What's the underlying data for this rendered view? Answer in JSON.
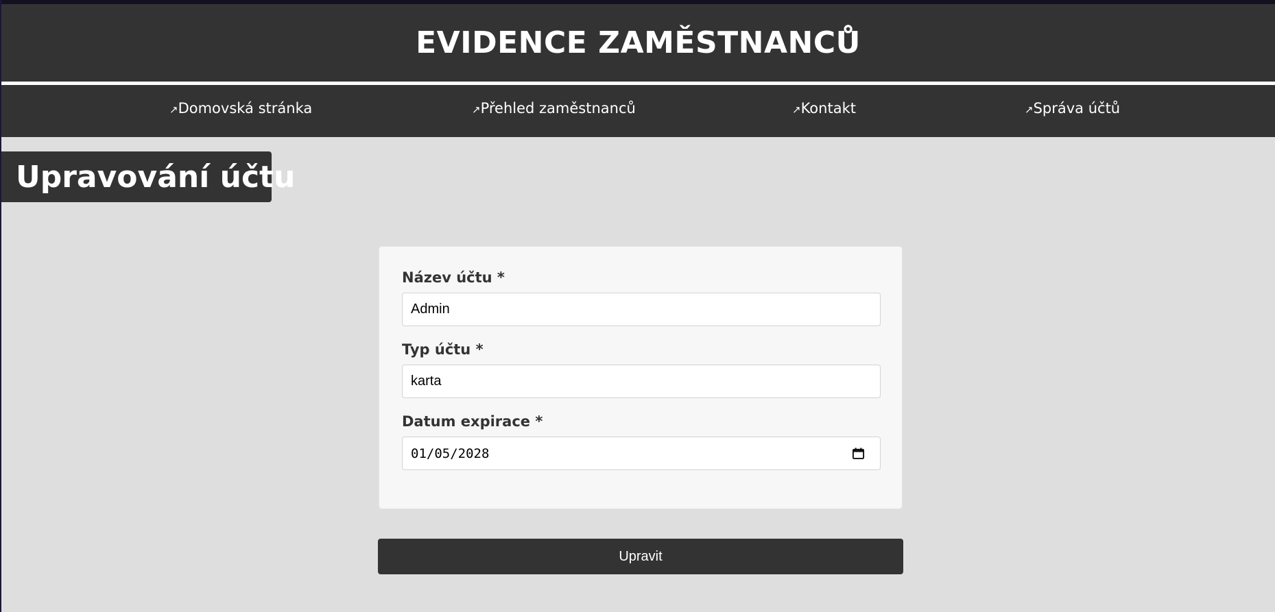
{
  "header": {
    "title": "EVIDENCE ZAMĚSTNANCŮ"
  },
  "nav": {
    "arrow": "↗",
    "items": [
      {
        "label": "Domovská stránka"
      },
      {
        "label": "Přehled zaměstnanců"
      },
      {
        "label": "Kontakt"
      },
      {
        "label": "Správa účtů"
      }
    ]
  },
  "page": {
    "heading": "Upravování účtu"
  },
  "form": {
    "account_name": {
      "label": "Název účtu *",
      "value": "Admin"
    },
    "account_type": {
      "label": "Typ účtu *",
      "value": "karta"
    },
    "expiration": {
      "label": "Datum expirace *",
      "value": "01/05/2028",
      "icon": "calendar-icon"
    },
    "submit_label": "Upravit"
  },
  "colors": {
    "header_bg": "#333333",
    "page_bg": "#dedede",
    "card_bg": "#f7f7f7",
    "text_light": "#ffffff",
    "text_dark": "#333333"
  }
}
